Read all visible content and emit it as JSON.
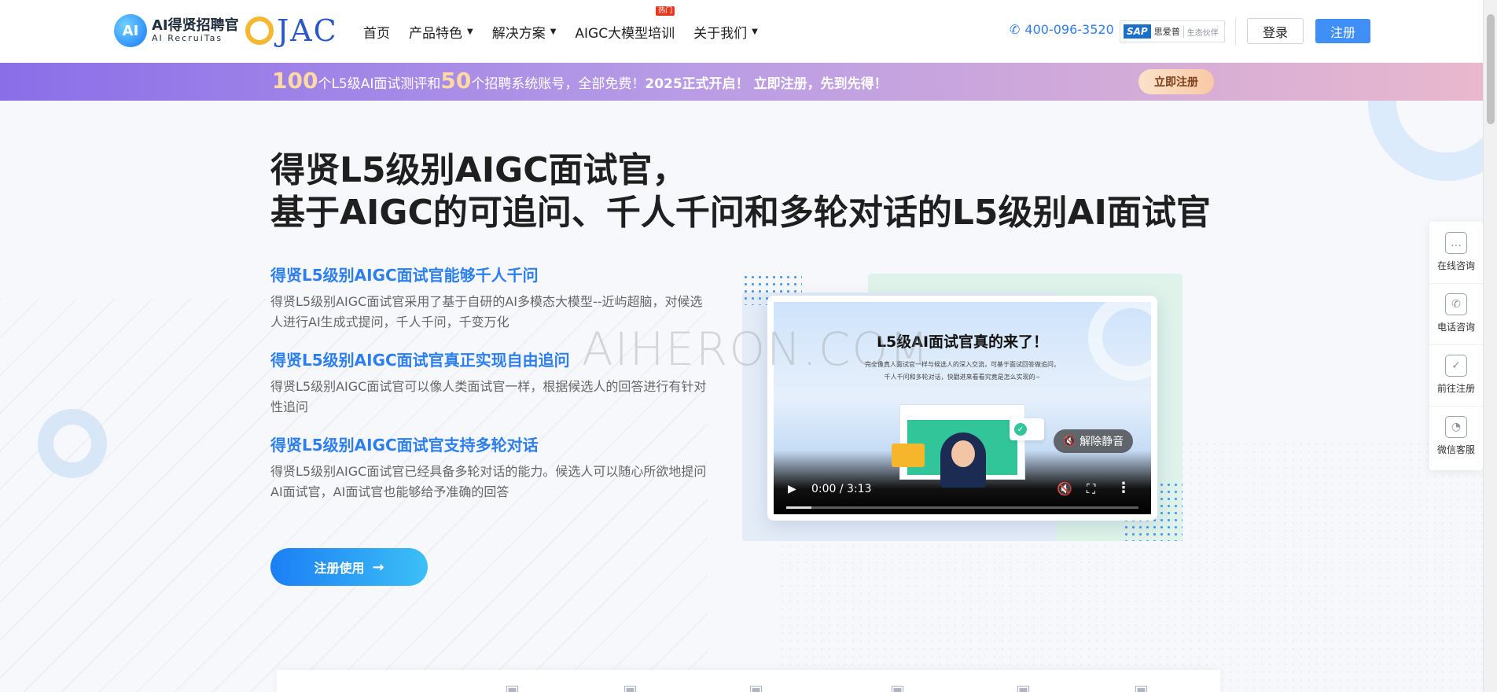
{
  "header": {
    "logo_title": "AI得贤招聘官",
    "logo_sub": "AI RecruiTas",
    "logo_mark": "AI",
    "partner_logo": "JAC",
    "nav": [
      {
        "label": "首页",
        "dropdown": false
      },
      {
        "label": "产品特色",
        "dropdown": true
      },
      {
        "label": "解决方案",
        "dropdown": true
      },
      {
        "label": "AIGC大模型培训",
        "dropdown": false,
        "badge": "热门"
      },
      {
        "label": "关于我们",
        "dropdown": true
      }
    ],
    "phone": "400-096-3520",
    "sap_logo": "SAP",
    "sap_text": "思爱普",
    "sap_sub": "生态伙伴",
    "login_label": "登录",
    "register_label": "注册"
  },
  "banner": {
    "num1": "100",
    "text1": "个L5级AI面试测评和",
    "num2": "50",
    "text2": "个招聘系统账号，全部免费！",
    "strong": "2025正式开启！ 立即注册，先到先得！",
    "button_label": "立即注册"
  },
  "hero": {
    "title_line1": "得贤L5级别AIGC面试官，",
    "title_line2": "基于AIGC的可追问、千人千问和多轮对话的L5级别AI面试官",
    "features": [
      {
        "title": "得贤L5级别AIGC面试官能够千人千问",
        "desc": "得贤L5级别AIGC面试官采用了基于自研的AI多模态大模型--近屿超脑，对候选人进行AI生成式提问，千人千问，千变万化"
      },
      {
        "title": "得贤L5级别AIGC面试官真正实现自由追问",
        "desc": "得贤L5级别AIGC面试官可以像人类面试官一样，根据候选人的回答进行有针对性追问"
      },
      {
        "title": "得贤L5级别AIGC面试官支持多轮对话",
        "desc": "得贤L5级别AIGC面试官已经具备多轮对话的能力。候选人可以随心所欲地提问AI面试官，AI面试官也能够给予准确的回答"
      }
    ],
    "cta_label": "注册使用"
  },
  "video": {
    "heading": "L5级AI面试官真的来了！",
    "sub1": "完全像真人面试官一样与候选人的深入交流，可基于面试回答做追问，",
    "sub2": "千人千问和多轮对话，快戳进来看看究竟是怎么实现的~",
    "unmute_label": "解除静音",
    "time": "0:00 / 3:13",
    "progress": 0
  },
  "watermark": "AIHERON.COM",
  "sidebar": [
    {
      "label": "在线咨询",
      "icon": "chat-icon"
    },
    {
      "label": "电话咨询",
      "icon": "phone-icon"
    },
    {
      "label": "前往注册",
      "icon": "register-icon"
    },
    {
      "label": "微信客服",
      "icon": "wechat-icon"
    }
  ],
  "colors": {
    "primary": "#2f7df6",
    "banner_start": "#8a6ee8",
    "banner_end": "#e9b8cd",
    "feature_title": "#2d7ff0"
  }
}
